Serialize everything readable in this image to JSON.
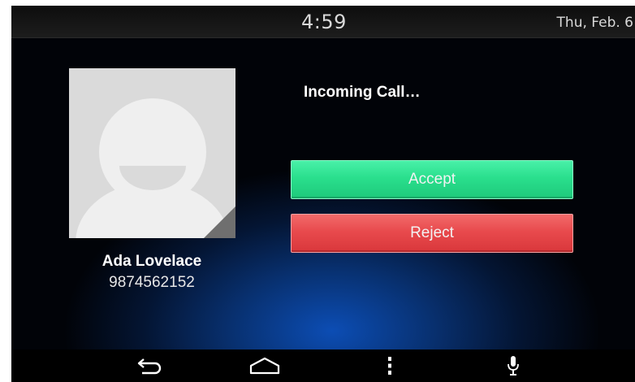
{
  "status_bar": {
    "time": "4:59",
    "date": "Thu, Feb. 6"
  },
  "call": {
    "title": "Incoming Call…",
    "caller_name": "Ada Lovelace",
    "caller_number": "9874562152",
    "accept_label": "Accept",
    "reject_label": "Reject"
  },
  "nav_bar": {
    "items": [
      "back-icon",
      "home-icon",
      "menu-icon",
      "microphone-icon"
    ]
  },
  "colors": {
    "accept": "#2adf8d",
    "reject": "#e84a4d",
    "background_glow": "#0c4db4"
  }
}
